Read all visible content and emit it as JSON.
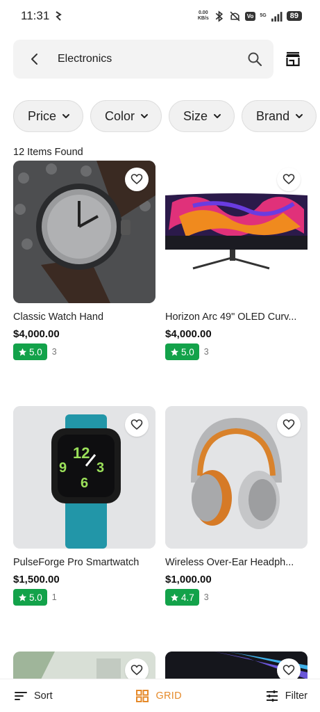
{
  "status": {
    "time": "11:31",
    "net_speed_value": "0.00",
    "net_speed_unit": "KB/s",
    "signal_label": "5G",
    "vo_label": "Vo",
    "battery": "89"
  },
  "search": {
    "query": "Electronics",
    "back_icon": "back-arrow-icon",
    "search_icon": "search-icon",
    "store_icon": "store-icon"
  },
  "filters": [
    {
      "label": "Price"
    },
    {
      "label": "Color"
    },
    {
      "label": "Size"
    },
    {
      "label": "Brand"
    }
  ],
  "results": {
    "count_text": "12 Items Found"
  },
  "products": [
    {
      "name": "Classic Watch Hand",
      "price": "$4,000.00",
      "rating": "5.0",
      "reviews": "3"
    },
    {
      "name": "Horizon Arc 49\" OLED Curv...",
      "price": "$4,000.00",
      "rating": "5.0",
      "reviews": "3"
    },
    {
      "name": "PulseForge Pro Smartwatch",
      "price": "$1,500.00",
      "rating": "5.0",
      "reviews": "1"
    },
    {
      "name": "Wireless Over-Ear Headph...",
      "price": "$1,000.00",
      "rating": "4.7",
      "reviews": "3"
    }
  ],
  "bottom_bar": {
    "sort_label": "Sort",
    "grid_label": "GRID",
    "filter_label": "Filter"
  },
  "colors": {
    "rating_badge": "#13a24a",
    "grid_accent": "#e58a2a",
    "chip_bg": "#f1f1f1"
  }
}
